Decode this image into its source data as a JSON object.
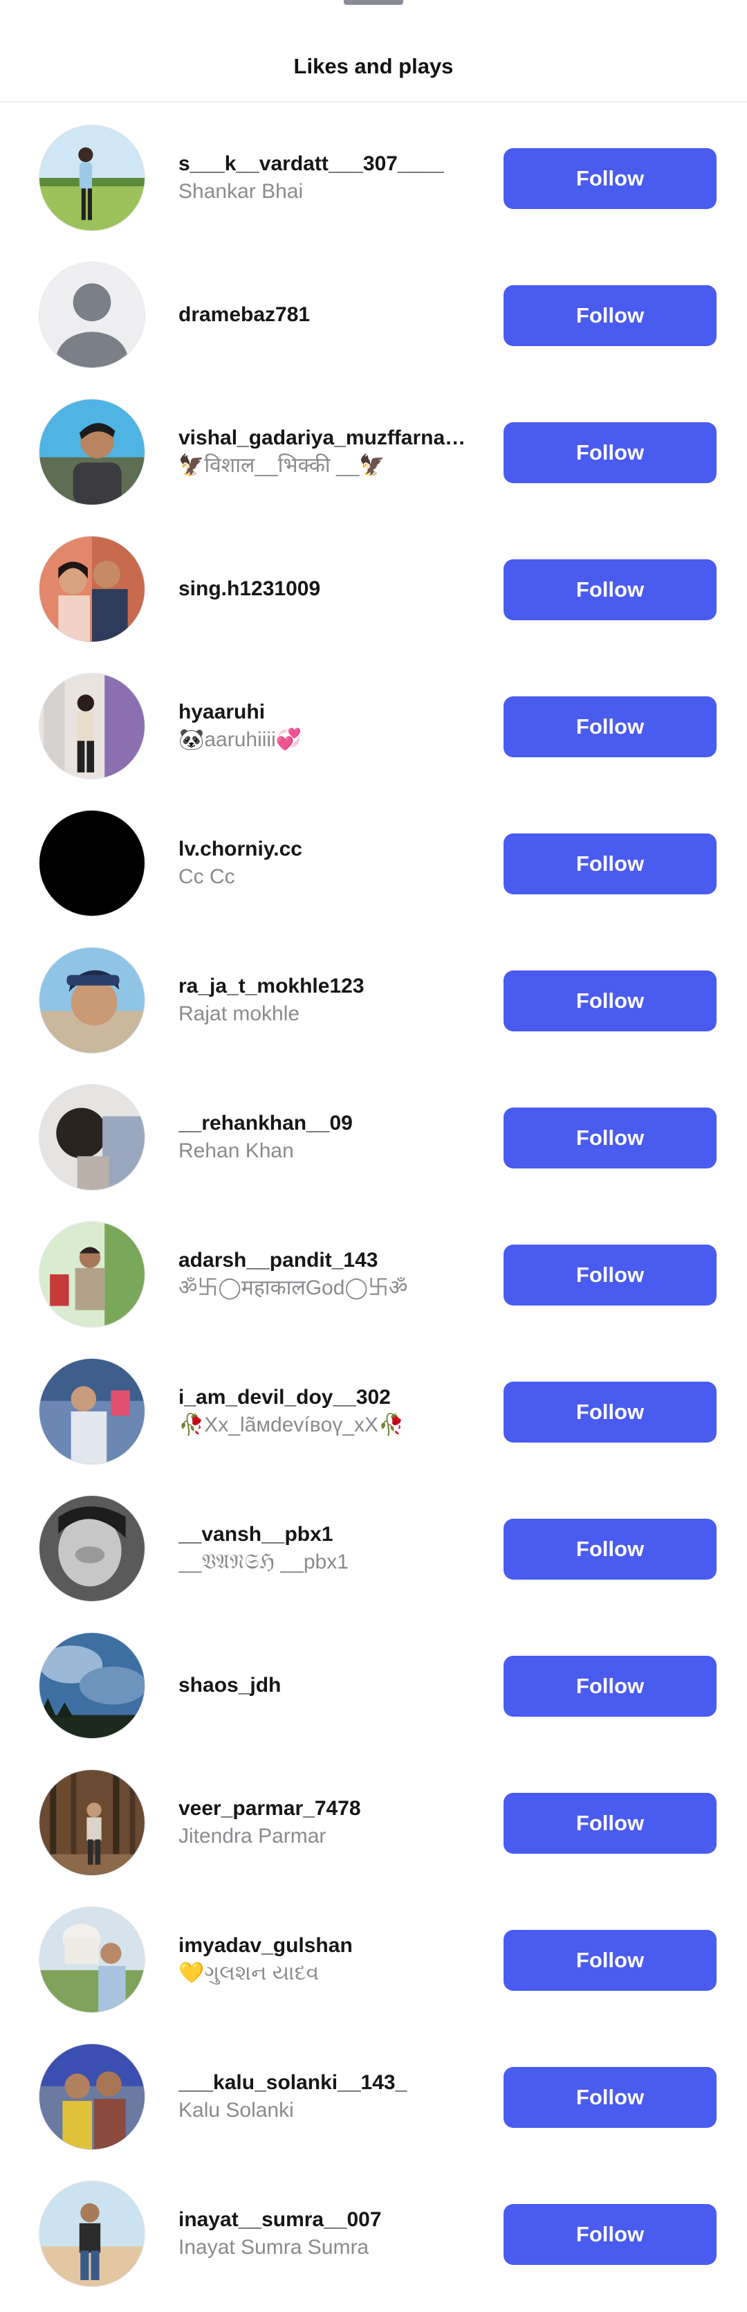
{
  "header": {
    "title": "Likes and plays"
  },
  "accent_color": "#4a5bef",
  "users": [
    {
      "username": "s___k__vardatt___307____",
      "full_name": "Shankar Bhai",
      "button": "Follow",
      "avatar": "photo"
    },
    {
      "username": "dramebaz781",
      "full_name": "",
      "button": "Follow",
      "avatar": "default-person-icon"
    },
    {
      "username": "vishal_gadariya_muzffarnagar",
      "full_name": "🦅विशाल__भिक्की __🦅",
      "button": "Follow",
      "avatar": "photo"
    },
    {
      "username": "sing.h1231009",
      "full_name": "",
      "button": "Follow",
      "avatar": "photo"
    },
    {
      "username": "hyaaruhi",
      "full_name": "🐼aaruhiiii💞",
      "button": "Follow",
      "avatar": "photo"
    },
    {
      "username": "lv.chorniy.cc",
      "full_name": "Cc Cc",
      "button": "Follow",
      "avatar": "black"
    },
    {
      "username": "ra_ja_t_mokhle123",
      "full_name": "Rajat mokhle",
      "button": "Follow",
      "avatar": "photo"
    },
    {
      "username": "__rehankhan__09",
      "full_name": "Rehan Khan",
      "button": "Follow",
      "avatar": "photo"
    },
    {
      "username": "adarsh__pandit_143",
      "full_name": "ॐ卐◯महाकालGod◯卐ॐ",
      "button": "Follow",
      "avatar": "photo"
    },
    {
      "username": "i_am_devil_doy__302",
      "full_name": "🥀Xx_lãмdevíвoү_xX🥀",
      "button": "Follow",
      "avatar": "photo"
    },
    {
      "username": "__vansh__pbx1",
      "full_name": "__𝔙𝔄𝔑𝔖ℌ __pbx1",
      "button": "Follow",
      "avatar": "photo"
    },
    {
      "username": "shaos_jdh",
      "full_name": "",
      "button": "Follow",
      "avatar": "photo"
    },
    {
      "username": "veer_parmar_7478",
      "full_name": "Jitendra Parmar",
      "button": "Follow",
      "avatar": "photo"
    },
    {
      "username": "imyadav_gulshan",
      "full_name": "💛ગુલશન યાદવ",
      "button": "Follow",
      "avatar": "photo"
    },
    {
      "username": "___kalu_solanki__143_",
      "full_name": "Kalu Solanki",
      "button": "Follow",
      "avatar": "photo"
    },
    {
      "username": "inayat__sumra__007",
      "full_name": "Inayat Sumra Sumra",
      "button": "Follow",
      "avatar": "photo"
    }
  ]
}
